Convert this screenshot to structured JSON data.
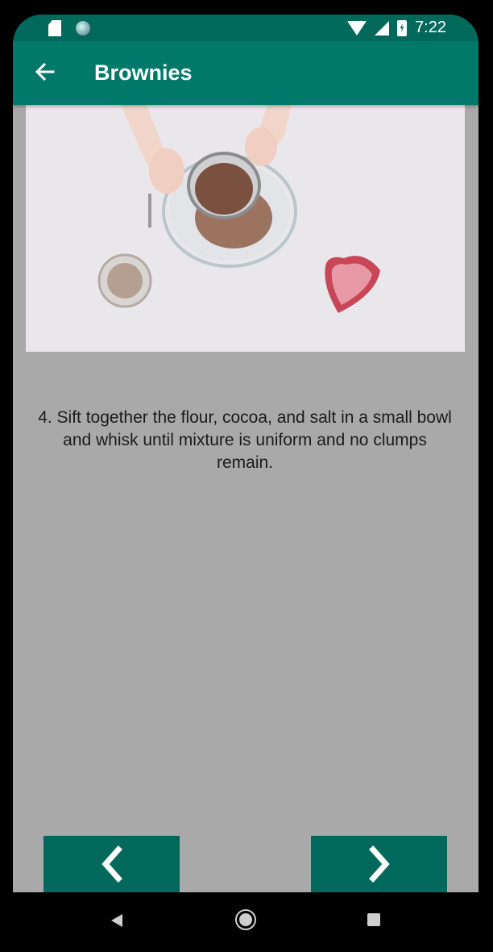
{
  "status_bar": {
    "time": "7:22",
    "icons": [
      "sd-card-icon",
      "notification-dot-icon",
      "wifi-icon",
      "signal-icon",
      "battery-charging-icon"
    ]
  },
  "app_bar": {
    "title": "Brownies",
    "back_icon": "arrow-left-icon"
  },
  "step": {
    "image": "step-photo",
    "description": "4. Sift together the flour, cocoa, and salt in a small bowl and whisk until mixture is uniform and no clumps remain."
  },
  "navigation": {
    "previous_icon": "chevron-left-icon",
    "next_icon": "chevron-right-icon"
  },
  "system_nav": {
    "icons": [
      "back-triangle-icon",
      "home-circle-icon",
      "recents-square-icon"
    ]
  },
  "colors": {
    "status_bar": "#00695c",
    "app_bar": "#00796b",
    "buttons": "#00695c",
    "background": "#a9a9a9"
  }
}
